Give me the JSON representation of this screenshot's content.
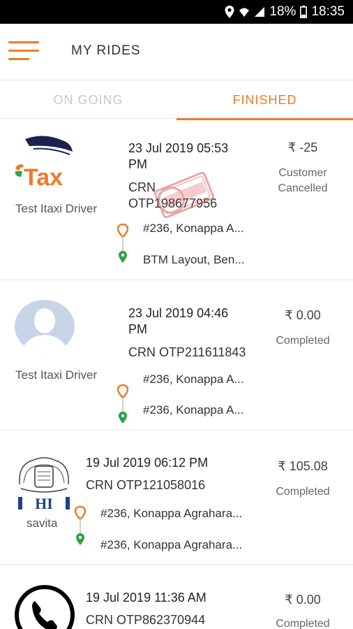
{
  "statusbar": {
    "battery_pct": "18%",
    "time": "18:35"
  },
  "appbar": {
    "title": "MY RIDES"
  },
  "tabs": {
    "ongoing": "ON GOING",
    "finished": "FINISHED"
  },
  "colors": {
    "accent": "#f07a28",
    "pickup": "#f07a28",
    "drop": "#2ea043"
  },
  "rides": [
    {
      "driver": "Test Itaxi Driver",
      "avatar": "itaxi-logo",
      "datetime_line1": "23 Jul 2019 05:53",
      "datetime_line2": "PM",
      "crn_line1": "CRN",
      "crn_line2": "OTP198677956",
      "pickup": "#236, Konappa A...",
      "drop": "BTM Layout, Ben...",
      "price": "₹ -25",
      "status_line1": "Customer",
      "status_line2": "Cancelled"
    },
    {
      "driver": "Test Itaxi Driver",
      "avatar": "person-placeholder",
      "datetime_line1": "23 Jul 2019 04:46",
      "datetime_line2": "PM",
      "crn": "CRN OTP211611843",
      "pickup": "#236, Konappa A...",
      "drop": "#236, Konappa A...",
      "price": "₹ 0.00",
      "status": "Completed"
    },
    {
      "driver": "savita",
      "avatar": "emblem-logo",
      "datetime": "19 Jul 2019 06:12 PM",
      "crn": "CRN OTP121058016",
      "pickup": "#236, Konappa Agrahara...",
      "drop": "#236, Konappa Agrahara...",
      "price": "₹ 105.08",
      "status": "Completed"
    },
    {
      "driver": "",
      "avatar": "phone-icon",
      "datetime": "19 Jul 2019 11:36 AM",
      "crn": "CRN OTP862370944",
      "price": "₹ 0.00",
      "status": "Completed"
    }
  ]
}
